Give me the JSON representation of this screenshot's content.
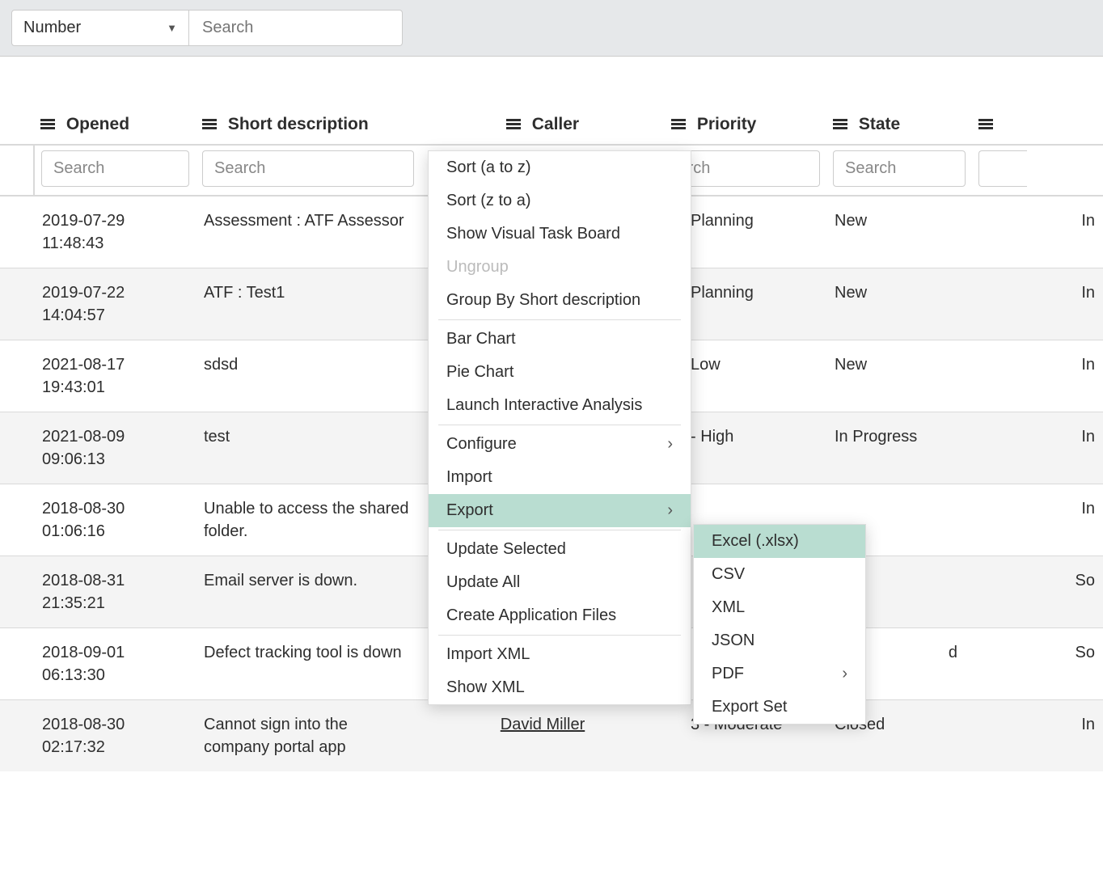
{
  "topbar": {
    "field_select": "Number",
    "search_placeholder": "Search"
  },
  "columns": {
    "opened": "Opened",
    "short_description": "Short description",
    "caller": "Caller",
    "priority": "Priority",
    "state": "State"
  },
  "search_placeholder": "Search",
  "rows": [
    {
      "opened": "2019-07-29 11:48:43",
      "desc": "Assessment : ATF Assessor",
      "priority": "Planning",
      "state": "New",
      "last": "In"
    },
    {
      "opened": "2019-07-22 14:04:57",
      "desc": "ATF : Test1",
      "priority": "Planning",
      "state": "New",
      "last": "In"
    },
    {
      "opened": "2021-08-17 19:43:01",
      "desc": "sdsd",
      "priority": "Low",
      "state": "New",
      "last": "In"
    },
    {
      "opened": "2021-08-09 09:06:13",
      "desc": "test",
      "priority": "- High",
      "state": "In Progress",
      "last": "In"
    },
    {
      "opened": "2018-08-30 01:06:16",
      "desc": "Unable to access the shared folder.",
      "priority": "",
      "state": "",
      "last": "In"
    },
    {
      "opened": "2018-08-31 21:35:21",
      "desc": "Email server is down.",
      "priority": "",
      "state": "",
      "last": "So"
    },
    {
      "opened": "2018-09-01 06:13:30",
      "desc": "Defect tracking tool is down",
      "priority": "",
      "state": "d",
      "last": "So"
    },
    {
      "opened": "2018-08-30 02:17:32",
      "desc": "Cannot sign into the company portal app",
      "caller": "David Miller",
      "priority": "3 - Moderate",
      "state": "Closed",
      "last": "In"
    }
  ],
  "context_menu": {
    "sort_az": "Sort (a to z)",
    "sort_za": "Sort (z to a)",
    "show_vtb": "Show Visual Task Board",
    "ungroup": "Ungroup",
    "group_by": "Group By Short description",
    "bar_chart": "Bar Chart",
    "pie_chart": "Pie Chart",
    "launch_analysis": "Launch Interactive Analysis",
    "configure": "Configure",
    "import": "Import",
    "export": "Export",
    "update_selected": "Update Selected",
    "update_all": "Update All",
    "create_app_files": "Create Application Files",
    "import_xml": "Import XML",
    "show_xml": "Show XML"
  },
  "export_submenu": {
    "excel": "Excel (.xlsx)",
    "csv": "CSV",
    "xml": "XML",
    "json": "JSON",
    "pdf": "PDF",
    "export_set": "Export Set"
  }
}
